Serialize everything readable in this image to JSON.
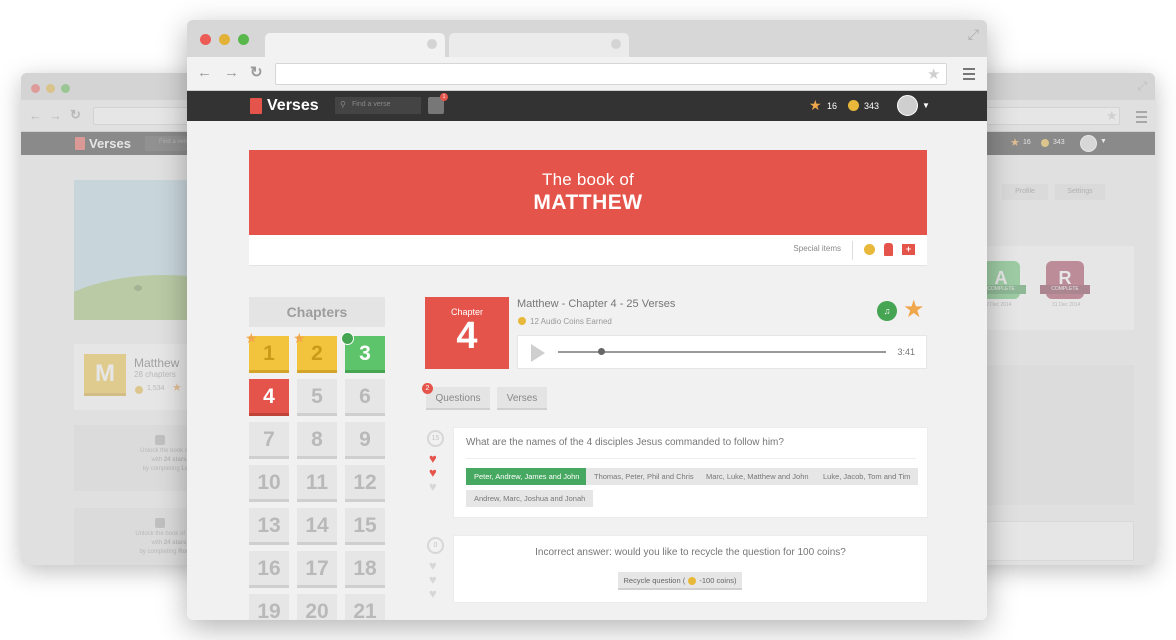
{
  "app": {
    "logo_text": "Verses",
    "search_placeholder": "Find a verse",
    "notif_count": "1",
    "stars": "16",
    "coins": "343"
  },
  "banner": {
    "line1": "The book of",
    "line2": "MATTHEW",
    "special_label": "Special items"
  },
  "chapters": {
    "heading": "Chapters",
    "tiles": [
      "1",
      "2",
      "3",
      "4",
      "5",
      "6",
      "7",
      "8",
      "9",
      "10",
      "11",
      "12",
      "13",
      "14",
      "15",
      "16",
      "17",
      "18",
      "19",
      "20",
      "21"
    ]
  },
  "chapter": {
    "label": "Chapter",
    "number": "4",
    "title": "Matthew - Chapter 4 - 25 Verses",
    "coins_text": "12 Audio Coins Earned",
    "duration": "3:41",
    "progress": 0.13
  },
  "tabs": {
    "questions": "Questions",
    "verses": "Verses",
    "question_badge": "2"
  },
  "question1": {
    "number": "15",
    "text": "What are the names of the 4 disciples Jesus commanded to follow him?",
    "answers": [
      "Peter, Andrew, James and John",
      "Thomas, Peter, Phil and Chris",
      "Marc, Luke, Matthew and John",
      "Luke, Jacob, Tom and Tim",
      "Andrew, Marc, Joshua and Jonah"
    ]
  },
  "question2": {
    "number": "0",
    "text": "Incorrect answer: would you like to recycle the question for 100 coins?",
    "button_label": "Recycle question (",
    "button_cost": "-100 coins)"
  },
  "left_window": {
    "logo_text": "Verses",
    "search_placeholder": "Find a verse",
    "book_title": "Matthew",
    "book_sub": "28 chapters",
    "book_coins": "1,534",
    "book_letter": "M",
    "lock1_line1": "Unlock the book of Jo",
    "lock1_line2": "with",
    "lock1_stars": "24 stars",
    "lock1_line3": "by completing",
    "lock1_book": "Luke",
    "lock2_line1": "Unlock the book of 1 Cori",
    "lock2_line2": "with",
    "lock2_stars": "24 stars",
    "lock2_line3": "by completing",
    "lock2_book": "Roman"
  },
  "right_window": {
    "stars": "16",
    "coins": "343",
    "tab_profile": "Profile",
    "tab_settings": "Settings",
    "badge_a": "A",
    "badge_r": "R",
    "badge_label": "COMPLETE",
    "date_a": "2 Dec 2014",
    "date_r": "31 Dec 2014"
  },
  "colors": {
    "accent": "#e5544a",
    "appbar": "#333333",
    "correct": "#47a861",
    "gold": "#f2c43d",
    "green": "#5dc46b"
  }
}
